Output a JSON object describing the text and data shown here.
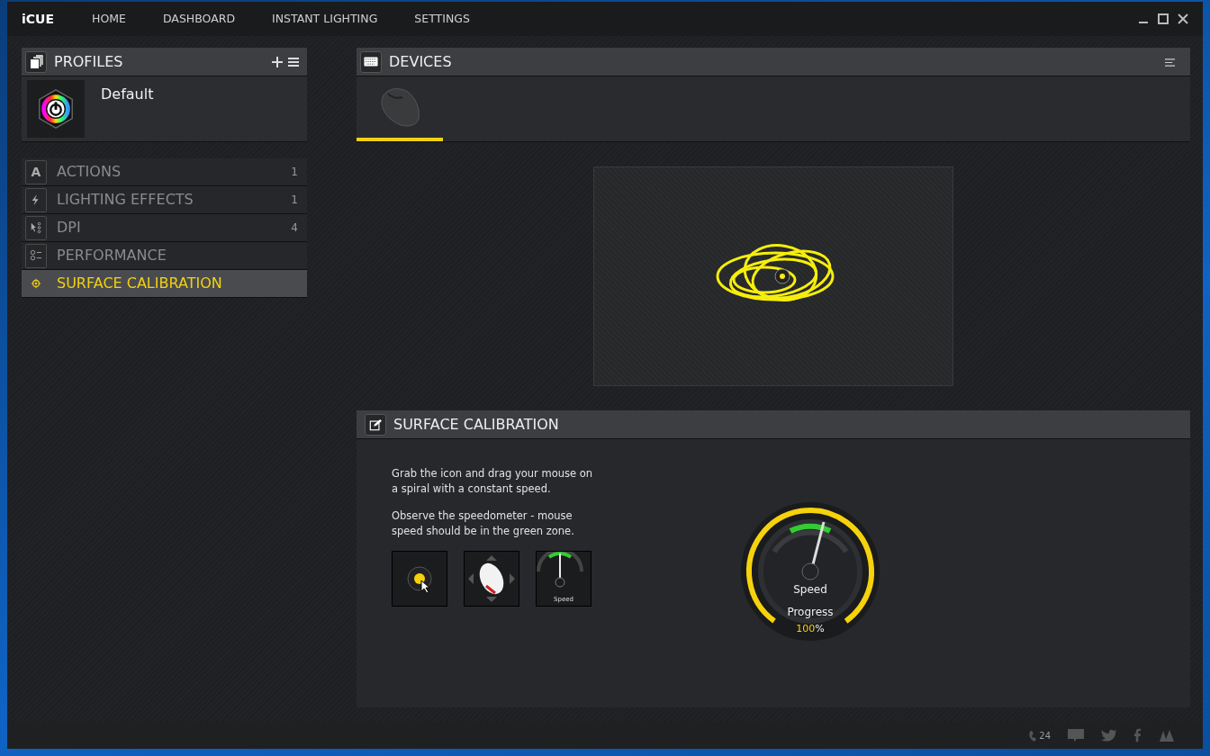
{
  "app": {
    "logo": "iCUE"
  },
  "nav": [
    "HOME",
    "DASHBOARD",
    "INSTANT LIGHTING",
    "SETTINGS"
  ],
  "profiles": {
    "title": "PROFILES",
    "items": [
      {
        "name": "Default"
      }
    ]
  },
  "sidebar": {
    "items": [
      {
        "label": "ACTIONS",
        "count": "1",
        "kind": "letter",
        "icon_text": "A",
        "selected": false
      },
      {
        "label": "LIGHTING EFFECTS",
        "count": "1",
        "kind": "bolt",
        "selected": false
      },
      {
        "label": "DPI",
        "count": "4",
        "kind": "dpi",
        "selected": false
      },
      {
        "label": "PERFORMANCE",
        "kind": "perf",
        "selected": false
      },
      {
        "label": "SURFACE CALIBRATION",
        "kind": "target",
        "selected": true
      }
    ]
  },
  "devices": {
    "title": "DEVICES",
    "tabs": [
      {
        "selected": true
      }
    ]
  },
  "calibration": {
    "title": "SURFACE CALIBRATION",
    "paragraphs": [
      "Grab the icon and drag your mouse on a spiral with a constant speed.",
      "Observe the speedometer - mouse speed should be in the green zone."
    ],
    "steps": [
      {
        "kind": "grab"
      },
      {
        "kind": "mouse"
      },
      {
        "kind": "gauge",
        "label": "Speed"
      }
    ],
    "gauge": {
      "speed_label": "Speed",
      "progress_label": "Progress",
      "progress_value": "100",
      "progress_unit": "%"
    }
  },
  "footer": {
    "support_badge": "24"
  }
}
